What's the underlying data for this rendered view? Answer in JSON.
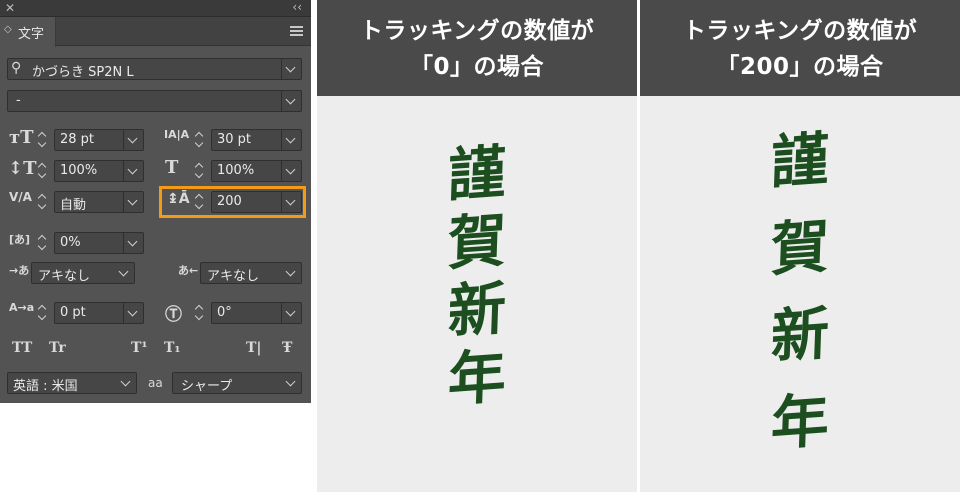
{
  "panel": {
    "title_close": "✕",
    "title_collapse": "‹‹",
    "tab_label": "文字",
    "font_family": "かづらき SP2N L",
    "font_style": "-",
    "font_size": "28 pt",
    "leading": "30 pt",
    "vertical_scale": "100%",
    "horizontal_scale": "100%",
    "kerning": "自動",
    "tracking": "200",
    "tsume": "0%",
    "mojikumi_before": "アキなし",
    "mojikumi_after": "アキなし",
    "baseline_shift": "0 pt",
    "char_rotation": "0°",
    "language": "英語 : 米国",
    "antialias_icon": "aa",
    "antialias": "シャープ",
    "style_buttons": [
      "TT",
      "Tr",
      "T¹",
      "T₁",
      "T|",
      "Ŧ"
    ]
  },
  "comparison": [
    {
      "header_line1": "トラッキングの数値が",
      "header_line2": "「0」の場合",
      "text": [
        "謹",
        "賀",
        "新",
        "年"
      ]
    },
    {
      "header_line1": "トラッキングの数値が",
      "header_line2": "「200」の場合",
      "text": [
        "謹",
        "賀",
        "新",
        "年"
      ]
    }
  ],
  "colors": {
    "highlight": "#f39a16",
    "calligraphy": "#1c4e1f",
    "header_bg": "#4a4a4a",
    "panel_bg": "#535353"
  }
}
